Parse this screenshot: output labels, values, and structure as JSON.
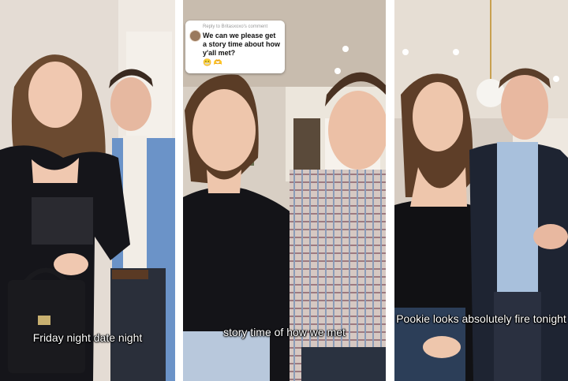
{
  "panels": [
    {
      "caption": "Friday night date night"
    },
    {
      "caption": "story time of how we met",
      "reply": {
        "meta": "Reply to Britasxoxo's comment",
        "text": "We can we please get a story time about how y'all met?",
        "emoji": "😬 🫶"
      }
    },
    {
      "caption": "Pookie looks absolutely fire tonight"
    }
  ]
}
